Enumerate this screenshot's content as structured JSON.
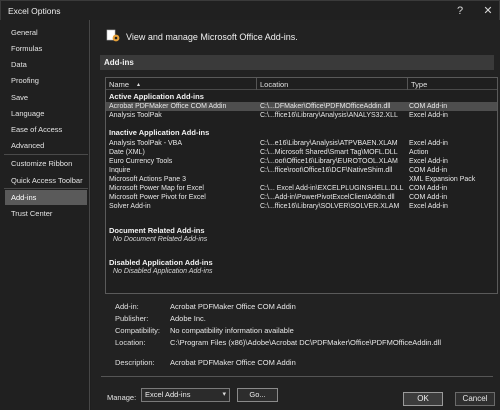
{
  "window": {
    "title": "Excel Options",
    "help_glyph": "?",
    "close_glyph": "✕"
  },
  "sidebar": {
    "items": [
      {
        "label": "General"
      },
      {
        "label": "Formulas"
      },
      {
        "label": "Data"
      },
      {
        "label": "Proofing"
      },
      {
        "label": "Save"
      },
      {
        "label": "Language"
      },
      {
        "label": "Ease of Access"
      },
      {
        "label": "Advanced"
      },
      {
        "label": "Customize Ribbon"
      },
      {
        "label": "Quick Access Toolbar"
      },
      {
        "label": "Add-ins"
      },
      {
        "label": "Trust Center"
      }
    ],
    "selected": "Add-ins"
  },
  "header": {
    "text": "View and manage Microsoft Office Add-ins.",
    "icon": "gear-addin-icon"
  },
  "section": {
    "title": "Add-ins"
  },
  "list": {
    "columns": {
      "name": "Name",
      "sort_glyph": "▴",
      "location": "Location",
      "type": "Type"
    },
    "groups": {
      "active": "Active Application Add-ins",
      "inactive": "Inactive Application Add-ins",
      "document": "Document Related Add-ins",
      "document_empty": "No Document Related Add-ins",
      "disabled": "Disabled Application Add-ins",
      "disabled_empty": "No Disabled Application Add-ins"
    },
    "active_rows": [
      {
        "name": "Acrobat PDFMaker Office COM Addin",
        "location": "C:\\...DFMaker\\Office\\PDFMOfficeAddin.dll",
        "type": "COM Add-in"
      },
      {
        "name": "Analysis ToolPak",
        "location": "C:\\...ffice16\\Library\\Analysis\\ANALYS32.XLL",
        "type": "Excel Add-in"
      }
    ],
    "inactive_rows": [
      {
        "name": "Analysis ToolPak - VBA",
        "location": "C:\\...e16\\Library\\Analysis\\ATPVBAEN.XLAM",
        "type": "Excel Add-in"
      },
      {
        "name": "Date (XML)",
        "location": "C:\\...Microsoft Shared\\Smart Tag\\MOFL.DLL",
        "type": "Action"
      },
      {
        "name": "Euro Currency Tools",
        "location": "C:\\...oot\\Office16\\Library\\EUROTOOL.XLAM",
        "type": "Excel Add-in"
      },
      {
        "name": "Inquire",
        "location": "C:\\...ffice\\root\\Office16\\DCF\\NativeShim.dll",
        "type": "COM Add-in"
      },
      {
        "name": "Microsoft Actions Pane 3",
        "location": "",
        "type": "XML Expansion Pack"
      },
      {
        "name": "Microsoft Power Map for Excel",
        "location": "C:\\... Excel Add-in\\EXCELPLUGINSHELL.DLL",
        "type": "COM Add-in"
      },
      {
        "name": "Microsoft Power Pivot for Excel",
        "location": "C:\\...Add-in\\PowerPivotExcelClientAddIn.dll",
        "type": "COM Add-in"
      },
      {
        "name": "Solver Add-in",
        "location": "C:\\...ffice16\\Library\\SOLVER\\SOLVER.XLAM",
        "type": "Excel Add-in"
      }
    ]
  },
  "details": {
    "addin_label": "Add-in:",
    "addin_value": "Acrobat PDFMaker Office COM Addin",
    "publisher_label": "Publisher:",
    "publisher_value": "Adobe Inc.",
    "compat_label": "Compatibility:",
    "compat_value": "No compatibility information available",
    "location_label": "Location:",
    "location_value": "C:\\Program Files (x86)\\Adobe\\Acrobat DC\\PDFMaker\\Office\\PDFMOfficeAddin.dll",
    "desc_label": "Description:",
    "desc_value": "Acrobat PDFMaker Office COM Addin"
  },
  "manage": {
    "label": "Manage:",
    "selected": "Excel Add-ins",
    "go": "Go..."
  },
  "footer": {
    "ok": "OK",
    "cancel": "Cancel"
  }
}
